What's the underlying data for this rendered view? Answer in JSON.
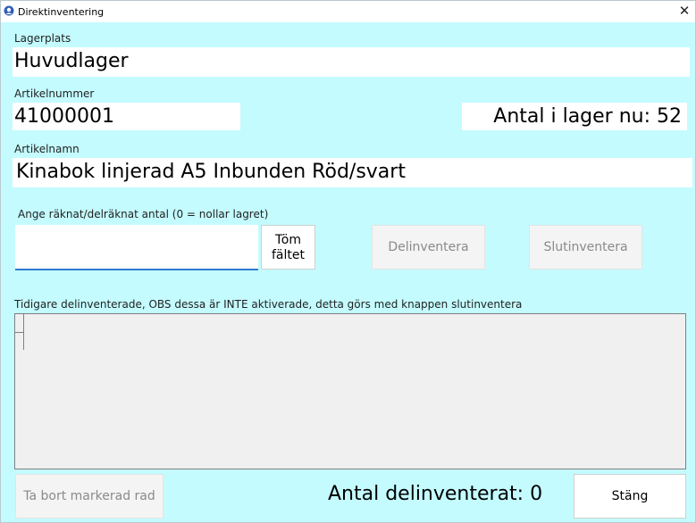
{
  "window": {
    "title": "Direktinventering",
    "close_glyph": "✕",
    "icon": "app-globe-icon"
  },
  "location": {
    "label": "Lagerplats",
    "value": "Huvudlager"
  },
  "article_number": {
    "label": "Artikelnummer",
    "value": "41000001"
  },
  "stock": {
    "text": "Antal i lager nu: 52"
  },
  "article_name": {
    "label": "Artikelnamn",
    "value": "Kinabok linjerad A5 Inbunden Röd/svart"
  },
  "count_input": {
    "label": "Ange räknat/delräknat antal (0 = nollar lagret)",
    "value": ""
  },
  "buttons": {
    "clear_line1": "Töm",
    "clear_line2": "fältet",
    "partial": "Delinventera",
    "final": "Slutinventera",
    "remove_row": "Ta bort markerad rad",
    "close": "Stäng"
  },
  "history": {
    "label": "Tidigare delinventerade, OBS dessa är INTE aktiverade, detta görs med knappen slutinventera"
  },
  "partial_count": {
    "text": "Antal delinventerat: 0"
  },
  "colors": {
    "background": "#c4fbff",
    "input_underline": "#2e7bcf"
  }
}
